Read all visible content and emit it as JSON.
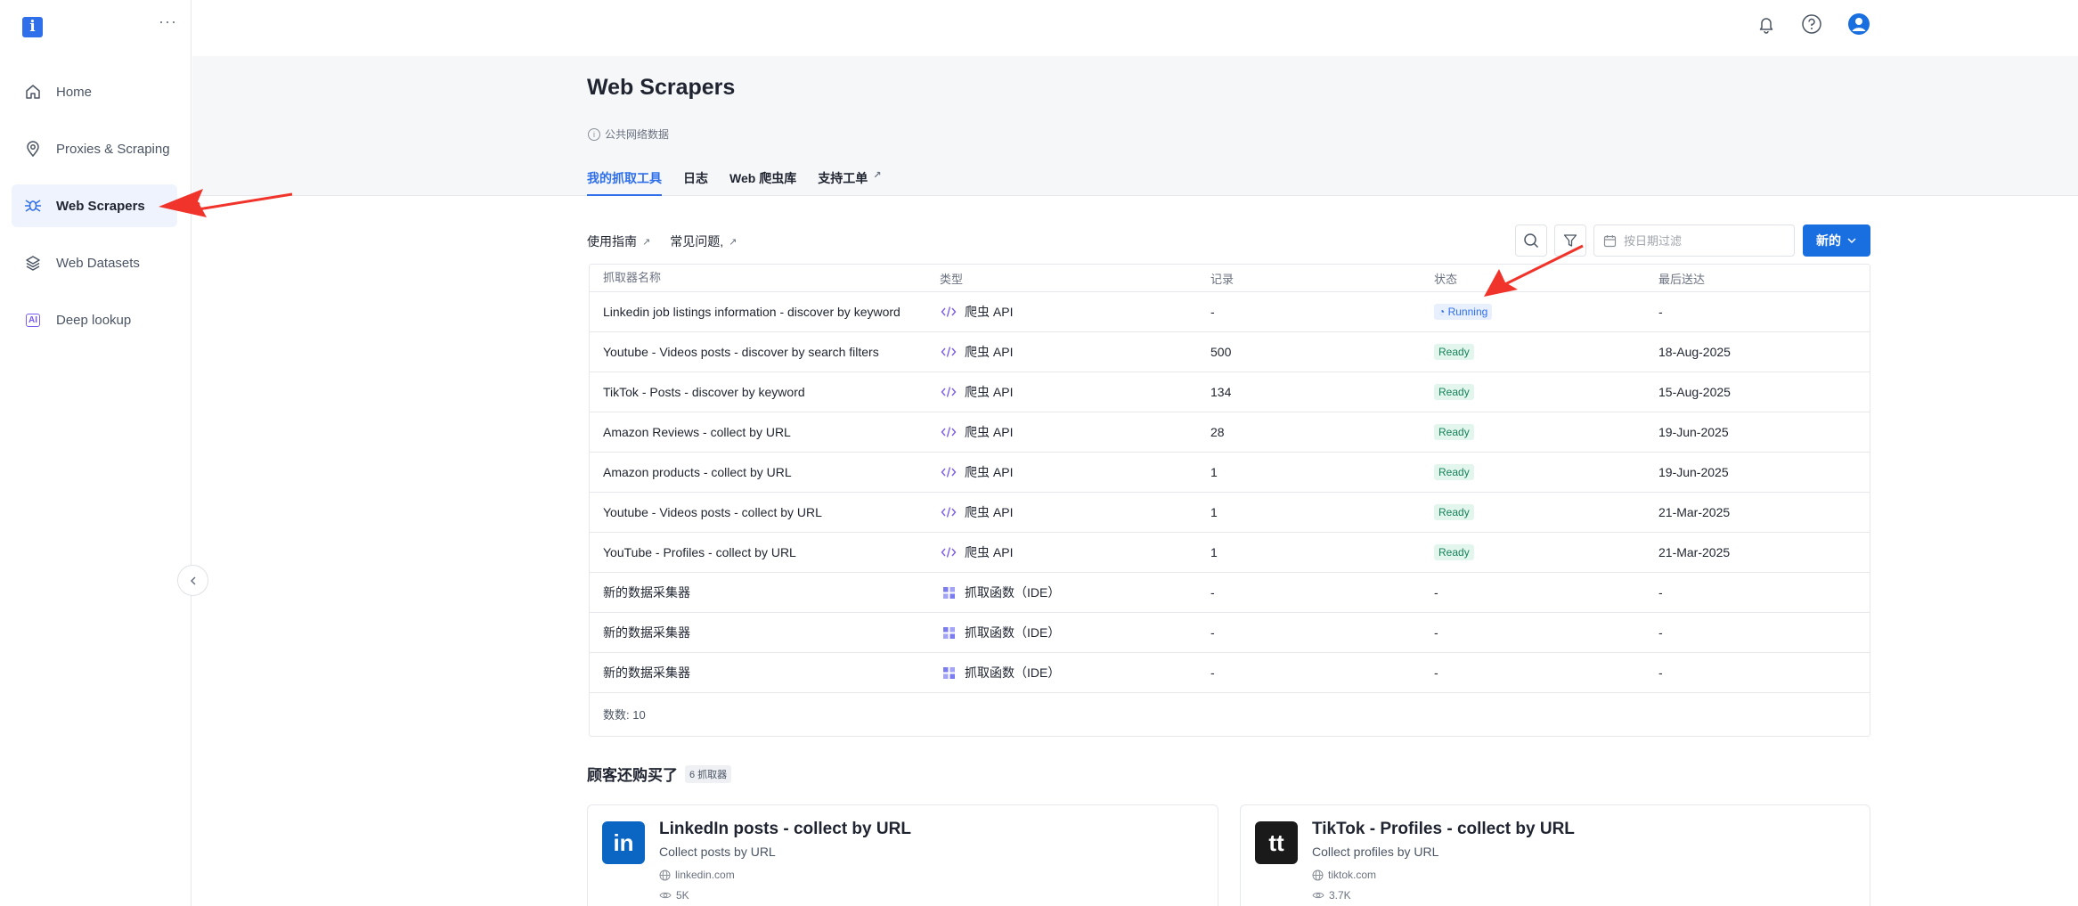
{
  "sidebar": {
    "logo": "i",
    "more": "···",
    "items": [
      {
        "label": "Home",
        "icon": "home-icon"
      },
      {
        "label": "Proxies & Scraping",
        "icon": "location-pin-icon"
      },
      {
        "label": "Web Scrapers",
        "icon": "spider-icon",
        "active": true
      },
      {
        "label": "Web Datasets",
        "icon": "layers-icon"
      },
      {
        "label": "Deep lookup",
        "icon": "ai-icon",
        "badge": "AI"
      }
    ]
  },
  "header": {
    "title": "Web Scrapers",
    "subtitle": "公共网络数据",
    "tabs": [
      {
        "label": "我的抓取工具",
        "active": true
      },
      {
        "label": "日志"
      },
      {
        "label": "Web 爬虫库"
      },
      {
        "label": "支持工单",
        "external": true
      }
    ]
  },
  "toolbar": {
    "guide_link": "使用指南",
    "faq_link": "常见问题,",
    "date_placeholder": "按日期过滤",
    "new_label": "新的"
  },
  "table": {
    "columns": [
      "抓取器名称",
      "类型",
      "记录",
      "状态",
      "最后送达"
    ],
    "rows": [
      {
        "name": "Linkedin job listings information - discover by keyword",
        "type": "爬虫 API",
        "type_icon": "code-icon",
        "records": "-",
        "status": "Running",
        "status_kind": "running",
        "last": "-"
      },
      {
        "name": "Youtube - Videos posts - discover by search filters",
        "type": "爬虫 API",
        "type_icon": "code-icon",
        "records": "500",
        "status": "Ready",
        "status_kind": "ready",
        "last": "18-Aug-2025"
      },
      {
        "name": "TikTok - Posts - discover by keyword",
        "type": "爬虫 API",
        "type_icon": "code-icon",
        "records": "134",
        "status": "Ready",
        "status_kind": "ready",
        "last": "15-Aug-2025"
      },
      {
        "name": "Amazon Reviews - collect by URL",
        "type": "爬虫 API",
        "type_icon": "code-icon",
        "records": "28",
        "status": "Ready",
        "status_kind": "ready",
        "last": "19-Jun-2025"
      },
      {
        "name": "Amazon products - collect by URL",
        "type": "爬虫 API",
        "type_icon": "code-icon",
        "records": "1",
        "status": "Ready",
        "status_kind": "ready",
        "last": "19-Jun-2025"
      },
      {
        "name": "Youtube - Videos posts - collect by URL",
        "type": "爬虫 API",
        "type_icon": "code-icon",
        "records": "1",
        "status": "Ready",
        "status_kind": "ready",
        "last": "21-Mar-2025"
      },
      {
        "name": "YouTube - Profiles - collect by URL",
        "type": "爬虫 API",
        "type_icon": "code-icon",
        "records": "1",
        "status": "Ready",
        "status_kind": "ready",
        "last": "21-Mar-2025"
      },
      {
        "name": "新的数据采集器",
        "type": "抓取函数（IDE）",
        "type_icon": "grid-icon",
        "records": "-",
        "status": "-",
        "status_kind": "none",
        "last": "-"
      },
      {
        "name": "新的数据采集器",
        "type": "抓取函数（IDE）",
        "type_icon": "grid-icon",
        "records": "-",
        "status": "-",
        "status_kind": "none",
        "last": "-"
      },
      {
        "name": "新的数据采集器",
        "type": "抓取函数（IDE）",
        "type_icon": "grid-icon",
        "records": "-",
        "status": "-",
        "status_kind": "none",
        "last": "-"
      }
    ],
    "footer": "数数: 10"
  },
  "also_bought": {
    "title": "顾客还购买了",
    "count": "6 抓取器",
    "cards": [
      {
        "logo": "in",
        "logo_color": "#0a66c2",
        "title": "LinkedIn posts - collect by URL",
        "subtitle": "Collect posts by URL",
        "domain": "linkedin.com",
        "views": "5K"
      },
      {
        "logo": "tt",
        "logo_color": "#1a1a1a",
        "title": "TikTok - Profiles - collect by URL",
        "subtitle": "Collect profiles by URL",
        "domain": "tiktok.com",
        "views": "3.7K"
      }
    ]
  },
  "colors": {
    "accent": "#1a6fe0",
    "ready": "#16825a",
    "running": "#2f6fea",
    "arrow": "#f0342b"
  }
}
